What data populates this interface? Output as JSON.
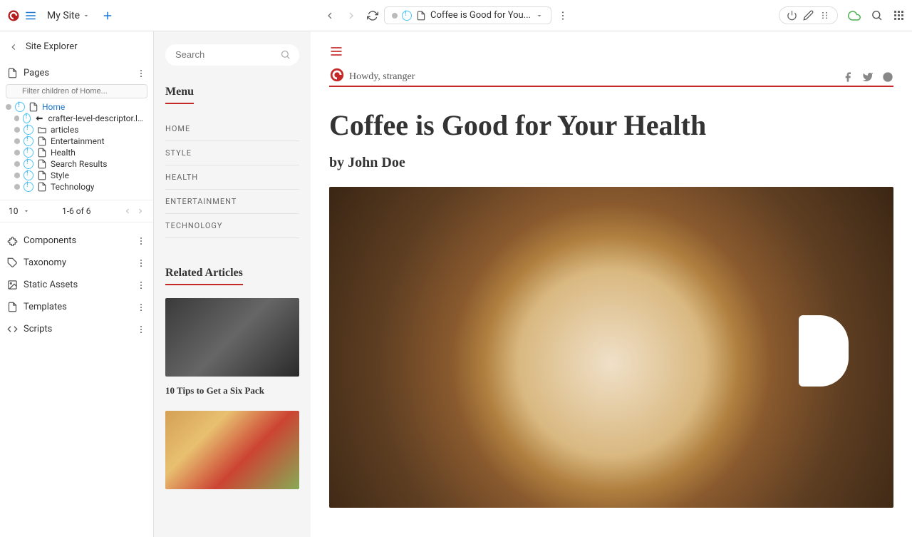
{
  "topbar": {
    "site_name": "My Site",
    "page_title": "Coffee is Good for You..."
  },
  "explorer": {
    "title": "Site Explorer",
    "pages_label": "Pages",
    "filter_placeholder": "Filter children of Home...",
    "tree": [
      {
        "name": "Home",
        "type": "page",
        "active": true
      },
      {
        "name": "crafter-level-descriptor.level.xml",
        "type": "xml"
      },
      {
        "name": "articles",
        "type": "folder"
      },
      {
        "name": "Entertainment",
        "type": "page"
      },
      {
        "name": "Health",
        "type": "page"
      },
      {
        "name": "Search Results",
        "type": "page"
      },
      {
        "name": "Style",
        "type": "page"
      },
      {
        "name": "Technology",
        "type": "page"
      }
    ],
    "pager": {
      "size": "10",
      "range": "1-6 of 6"
    },
    "sections": [
      "Components",
      "Taxonomy",
      "Static Assets",
      "Templates",
      "Scripts"
    ]
  },
  "rail": {
    "search_placeholder": "Search",
    "menu_label": "Menu",
    "menu_items": [
      "HOME",
      "STYLE",
      "HEALTH",
      "ENTERTAINMENT",
      "TECHNOLOGY"
    ],
    "related_label": "Related Articles",
    "related": [
      {
        "title": "10 Tips to Get a Six Pack"
      },
      {
        "title": ""
      }
    ]
  },
  "content": {
    "greeting": "Howdy, stranger",
    "title": "Coffee is Good for Your Health",
    "byline": "by John Doe"
  }
}
